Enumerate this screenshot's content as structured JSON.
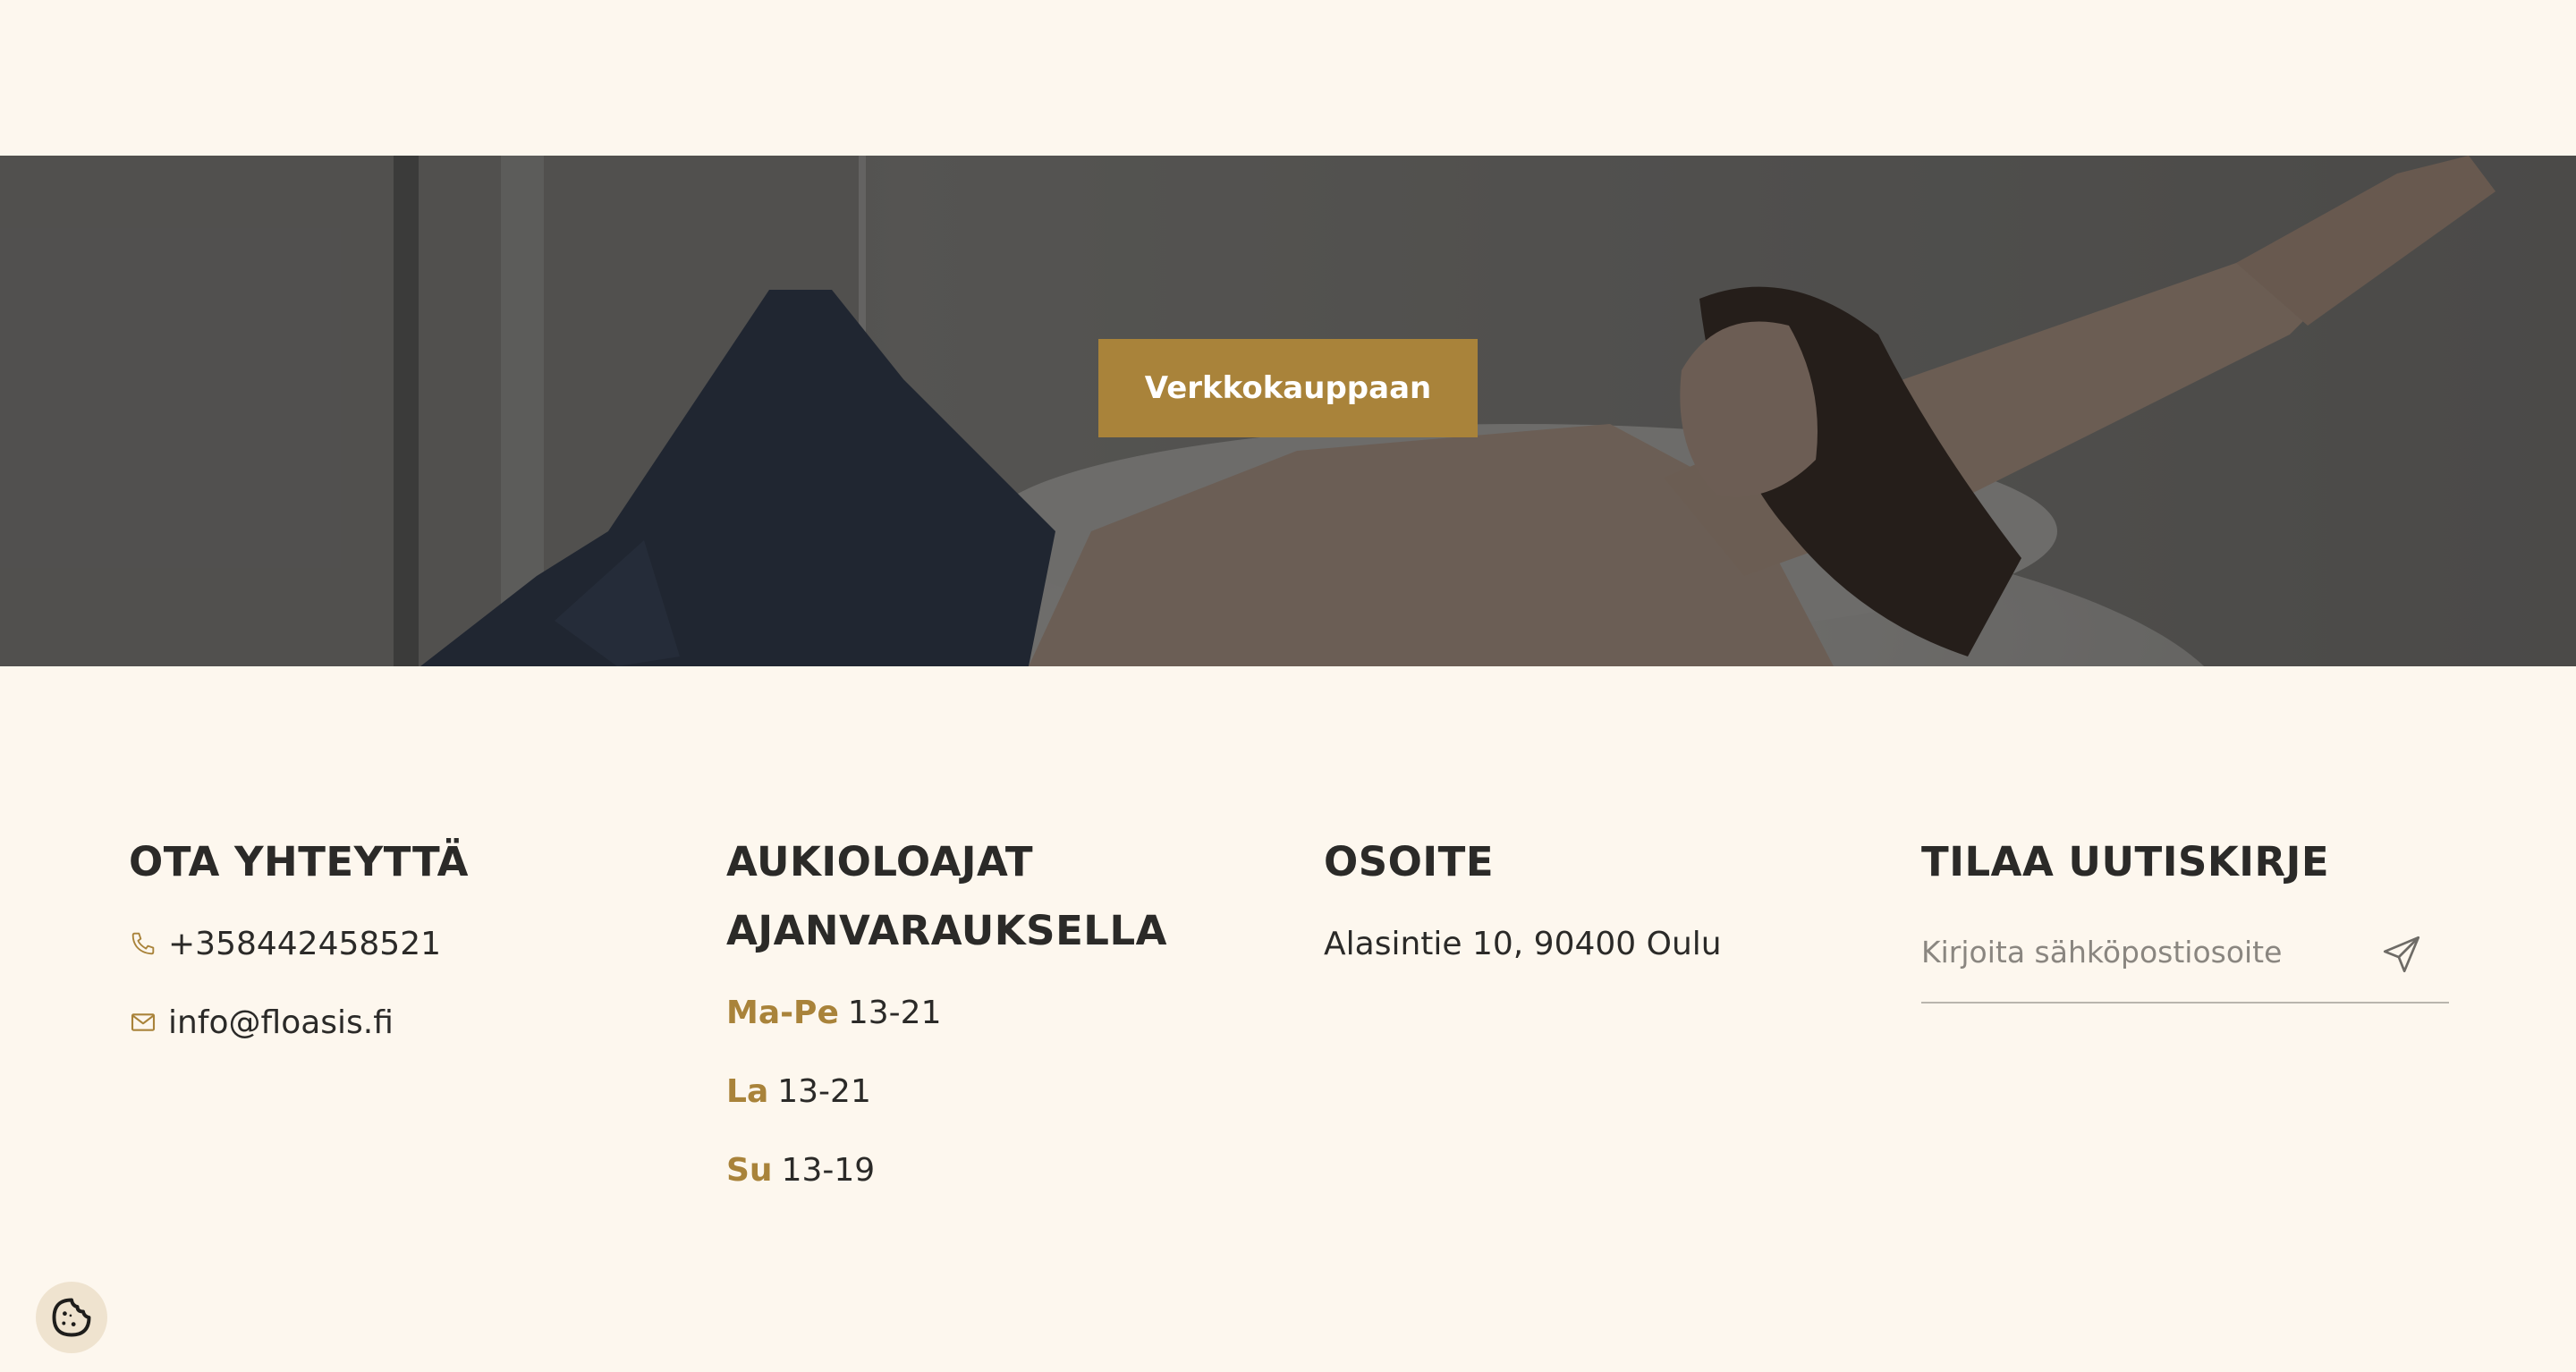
{
  "hero": {
    "button_label": "Verkkokauppaan"
  },
  "footer": {
    "contact": {
      "heading": "OTA YHTEYTTÄ",
      "phone": "+358442458521",
      "email": "info@floasis.fi"
    },
    "hours": {
      "heading_line1": "AUKIOLOAJAT",
      "heading_line2": "AJANVARAUKSELLA",
      "rows": [
        {
          "day": "Ma-Pe",
          "time": "13-21"
        },
        {
          "day": "La",
          "time": "13-21"
        },
        {
          "day": "Su",
          "time": "13-19"
        }
      ]
    },
    "address": {
      "heading": "OSOITE",
      "text": "Alasintie 10, 90400 Oulu"
    },
    "newsletter": {
      "heading": "TILAA UUTISKIRJE",
      "placeholder": "Kirjoita sähköpostiosoite"
    }
  },
  "icons": {
    "phone": "phone-icon",
    "email": "mail-icon",
    "send": "send-icon",
    "cookie": "cookie-icon"
  },
  "colors": {
    "background": "#fdf7ee",
    "accent": "#a9833a",
    "text": "#2b2a28"
  }
}
